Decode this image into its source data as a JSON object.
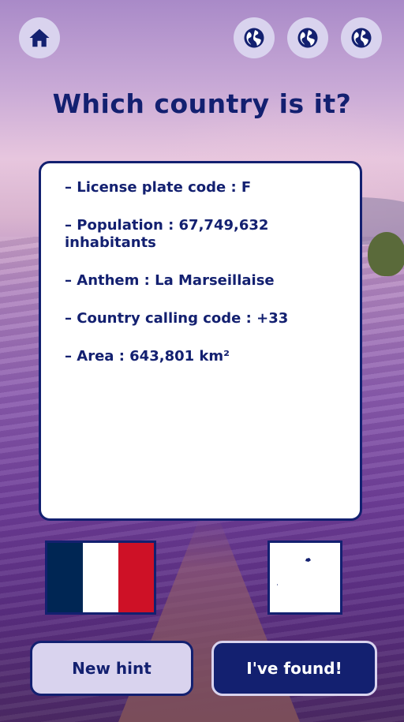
{
  "header": {
    "home_icon": "home-icon",
    "globe_icons": [
      "globe-icon",
      "globe-icon",
      "globe-icon"
    ]
  },
  "title": "Which country is it?",
  "hints": [
    "– License plate code : F",
    "– Population : 67,749,632 inhabitants",
    "– Anthem : La Marseillaise",
    "– Country calling code : +33",
    "– Area : 643,801 km²"
  ],
  "flag": {
    "name": "flag-of-france",
    "colors": [
      "#002654",
      "#ffffff",
      "#ce1126"
    ]
  },
  "map": {
    "name": "country-map-thumbnail"
  },
  "buttons": {
    "new_hint": "New hint",
    "found": "I've found!"
  },
  "colors": {
    "accent": "#132070",
    "button_light": "#d9d3ee",
    "card": "#ffffff"
  }
}
